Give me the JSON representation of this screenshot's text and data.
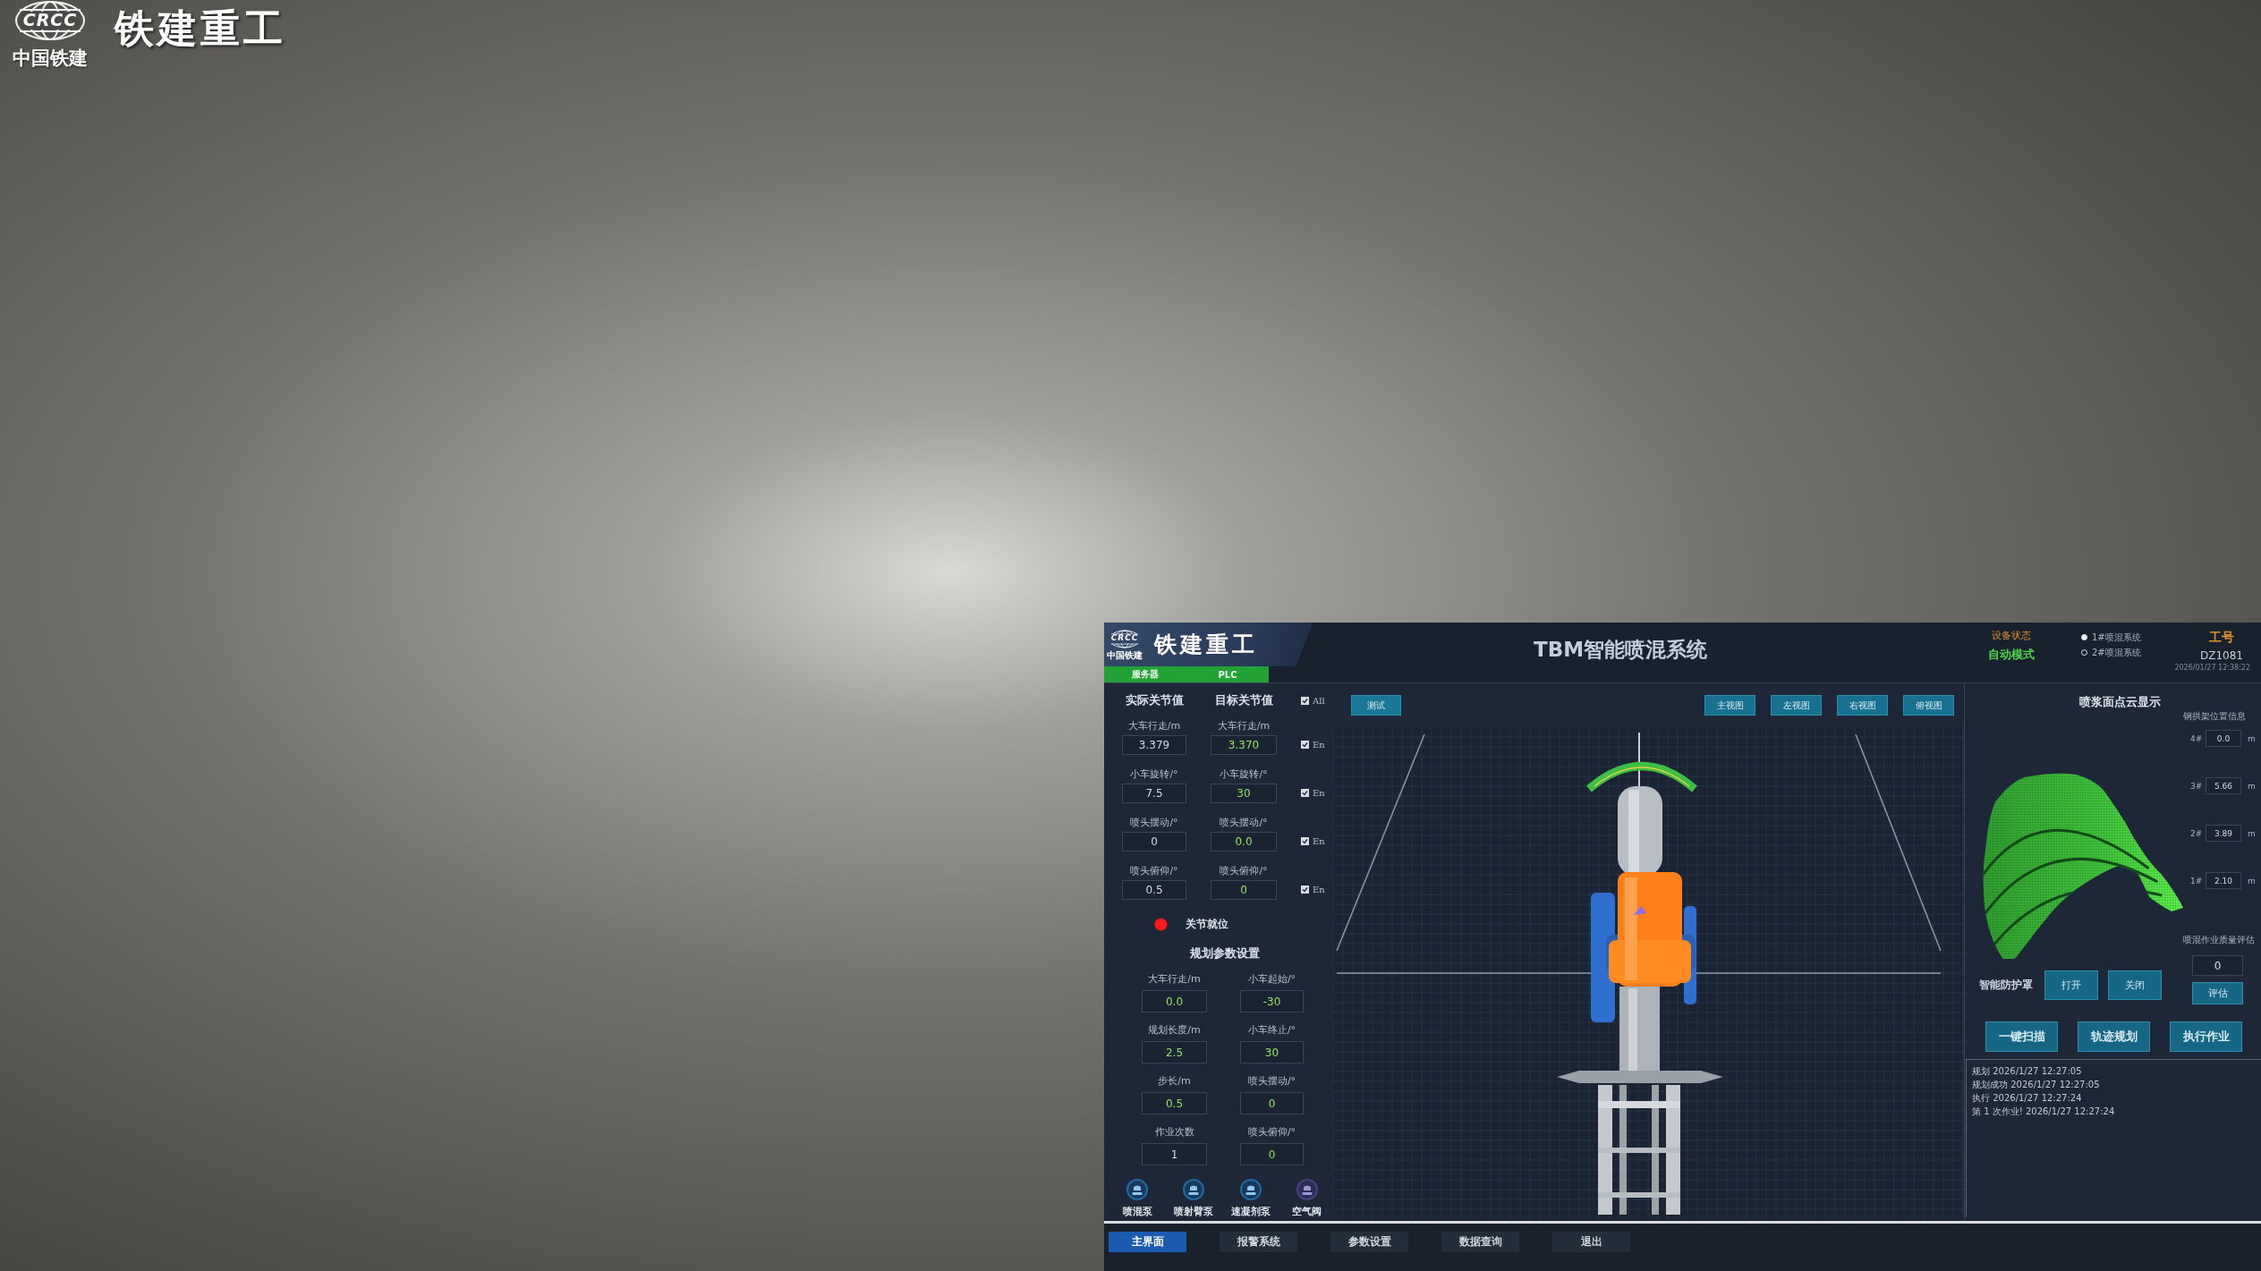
{
  "logo": {
    "emblem": "CRCC",
    "company": "中国铁建",
    "brand": "铁建重工"
  },
  "panel": {
    "header": {
      "logo": {
        "emblem": "CRCC",
        "company": "中国铁建",
        "brand": "铁建重工"
      },
      "links": [
        {
          "label": "服务器",
          "on": true
        },
        {
          "label": "PLC",
          "on": true
        }
      ],
      "title": "TBM智能喷混系统",
      "status": {
        "label": "设备状态",
        "value": "自动模式"
      },
      "systems": [
        {
          "label": "1#喷混系统",
          "selected": true
        },
        {
          "label": "2#喷混系统",
          "selected": false
        }
      ],
      "job": {
        "label": "工号",
        "value": "DZ1081"
      },
      "timestamp": "2026/01/27 12:38:22"
    },
    "joints": {
      "headings": [
        "实际关节值",
        "目标关节值"
      ],
      "all": {
        "label": "All",
        "checked": true
      },
      "rows": [
        {
          "actual_label": "大车行走/m",
          "actual": "3.379",
          "target_label": "大车行走/m",
          "target": "3.370",
          "enable": {
            "label": "En",
            "checked": true
          }
        },
        {
          "actual_label": "小车旋转/°",
          "actual": "7.5",
          "target_label": "小车旋转/°",
          "target": "30",
          "enable": {
            "label": "En",
            "checked": true
          }
        },
        {
          "actual_label": "喷头摆动/°",
          "actual": "0",
          "target_label": "喷头摆动/°",
          "target": "0.0",
          "enable": {
            "label": "En",
            "checked": true
          }
        },
        {
          "actual_label": "喷头俯仰/°",
          "actual": "0.5",
          "target_label": "喷头俯仰/°",
          "target": "0",
          "enable": {
            "label": "En",
            "checked": true
          }
        }
      ]
    },
    "in_position": {
      "label": "关节就位",
      "ready": false
    },
    "planning": {
      "title": "规划参数设置",
      "fields": [
        {
          "label": "大车行走/m",
          "value": "0.0",
          "kind": "setpoint"
        },
        {
          "label": "小车起始/°",
          "value": "-30",
          "kind": "setpoint"
        },
        {
          "label": "规划长度/m",
          "value": "2.5",
          "kind": "setpoint"
        },
        {
          "label": "小车终止/°",
          "value": "30",
          "kind": "setpoint"
        },
        {
          "label": "步长/m",
          "value": "0.5",
          "kind": "setpoint"
        },
        {
          "label": "喷头摆动/°",
          "value": "0",
          "kind": "setpoint"
        },
        {
          "label": "作业次数",
          "value": "1",
          "kind": "readout"
        },
        {
          "label": "喷头俯仰/°",
          "value": "0",
          "kind": "setpoint"
        }
      ]
    },
    "pumps": [
      {
        "label": "喷混泵",
        "on": true
      },
      {
        "label": "喷射臂泵",
        "on": true
      },
      {
        "label": "速凝剂泵",
        "on": true
      },
      {
        "label": "空气阀",
        "on": false
      }
    ],
    "toolbar": {
      "test": "测试",
      "views": [
        "主视图",
        "左视图",
        "右视图",
        "俯视图"
      ]
    },
    "cloud": {
      "title": "喷浆面点云显示",
      "arch_title": "钢拱架位置信息",
      "arches": [
        {
          "label": "4#",
          "value": "0.0",
          "unit": "m"
        },
        {
          "label": "3#",
          "value": "5.66",
          "unit": "m"
        },
        {
          "label": "2#",
          "value": "3.89",
          "unit": "m"
        },
        {
          "label": "1#",
          "value": "2.10",
          "unit": "m"
        }
      ],
      "quality": {
        "label": "喷混作业质量评估",
        "value": "0",
        "button": "评估"
      },
      "shield": {
        "label": "智能防护罩",
        "buttons": [
          "打开",
          "关闭"
        ]
      },
      "actions": [
        "一键扫描",
        "轨迹规划",
        "执行作业"
      ],
      "log": [
        "规划 2026/1/27 12:27:05",
        "规划成功 2026/1/27 12:27:05",
        "执行 2026/1/27 12:27:24",
        "第 1 次作业! 2026/1/27 12:27:24"
      ]
    },
    "nav": [
      {
        "label": "主界面",
        "selected": true
      },
      {
        "label": "报警系统",
        "selected": false
      },
      {
        "label": "参数设置",
        "selected": false
      },
      {
        "label": "数据查询",
        "selected": false
      },
      {
        "label": "退出",
        "selected": false
      }
    ]
  }
}
